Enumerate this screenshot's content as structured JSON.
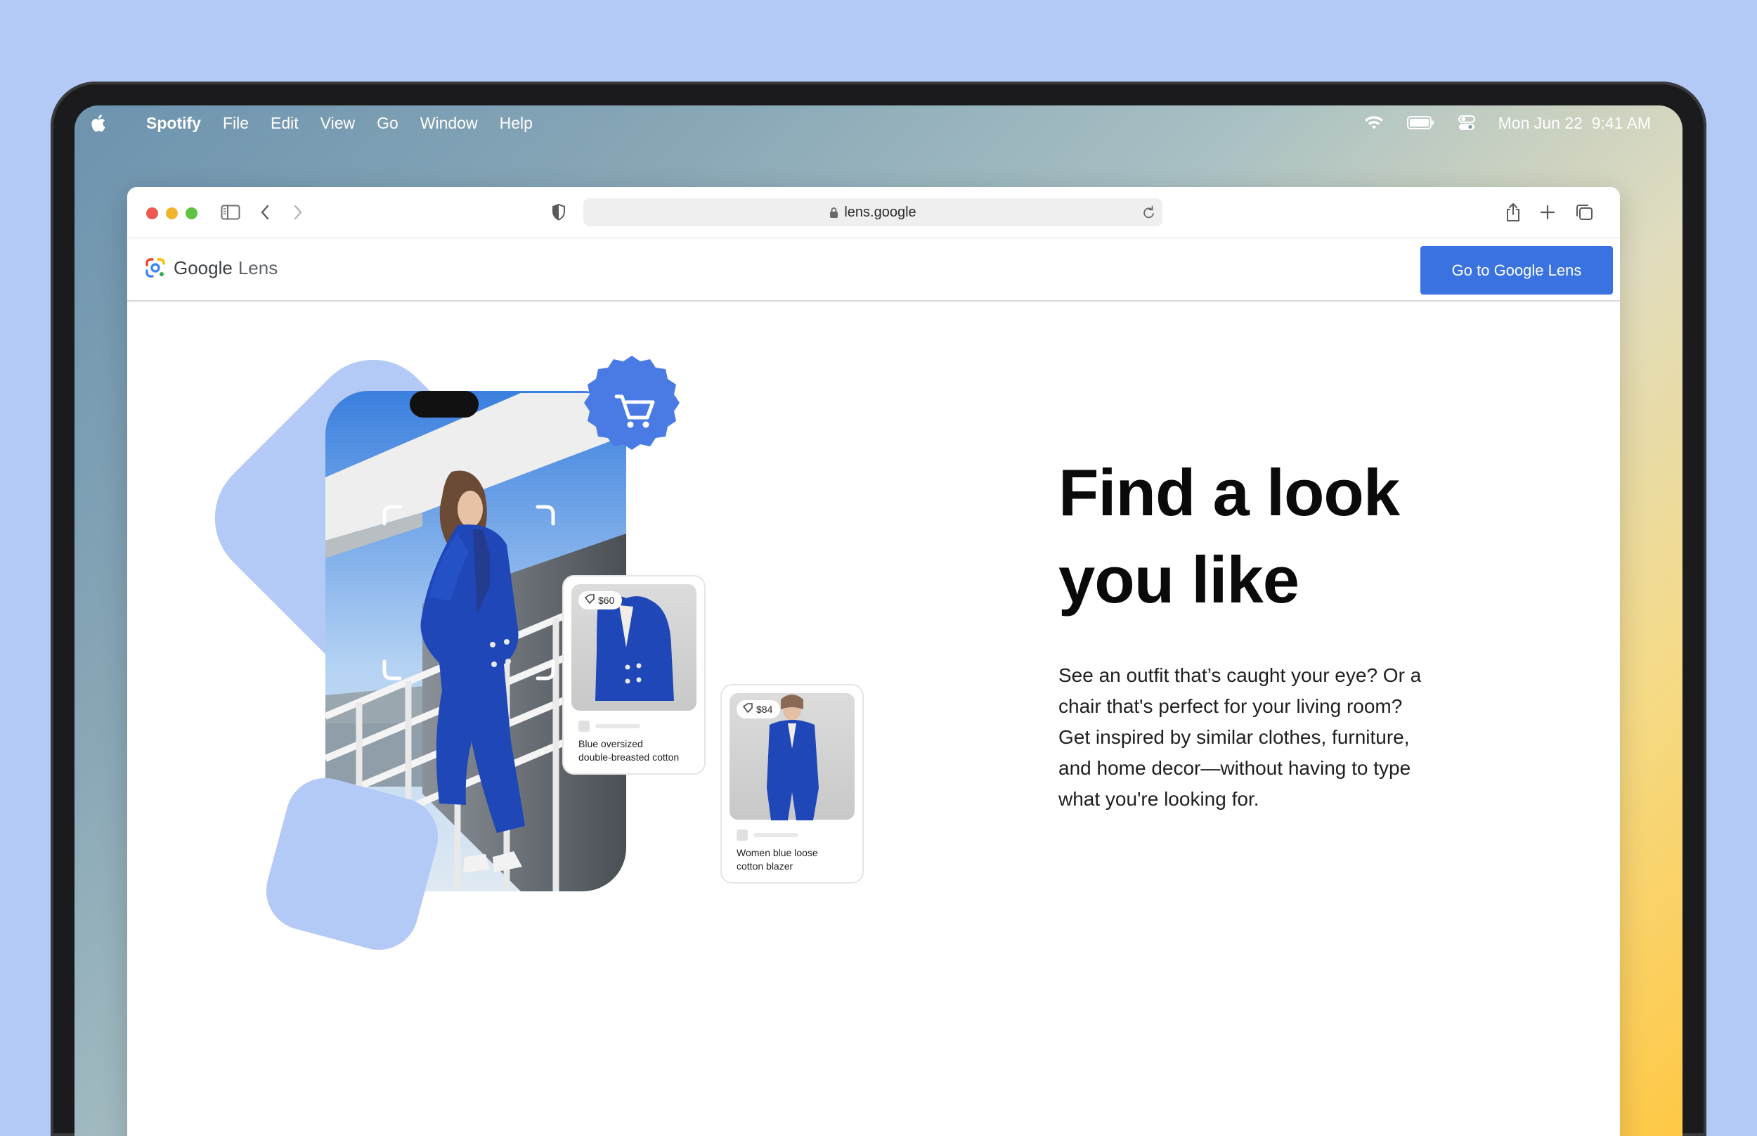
{
  "menubar": {
    "app_name": "Spotify",
    "items": [
      "File",
      "Edit",
      "View",
      "Go",
      "Window",
      "Help"
    ],
    "date_time": "Mon Jun 22  9:41 AM"
  },
  "browser": {
    "url": "lens.google"
  },
  "site": {
    "logo_google": "Google",
    "logo_lens": "Lens",
    "cta_label": "Go to Google Lens"
  },
  "hero": {
    "headline_line1": "Find a look",
    "headline_line2": "you like",
    "description": "See an outfit that’s caught your eye? Or a chair that's perfect for your living room? Get inspired by similar clothes, furniture, and home decor—without having to type what you're looking for."
  },
  "products": [
    {
      "price": "$60",
      "name_line1": "Blue oversized",
      "name_line2": "double-breasted cotton"
    },
    {
      "price": "$84",
      "name_line1": "Women blue loose",
      "name_line2": "cotton blazer"
    }
  ],
  "colors": {
    "accent": "#3a73e0",
    "shape": "#b3c9f6",
    "suit": "#1f47b8"
  }
}
